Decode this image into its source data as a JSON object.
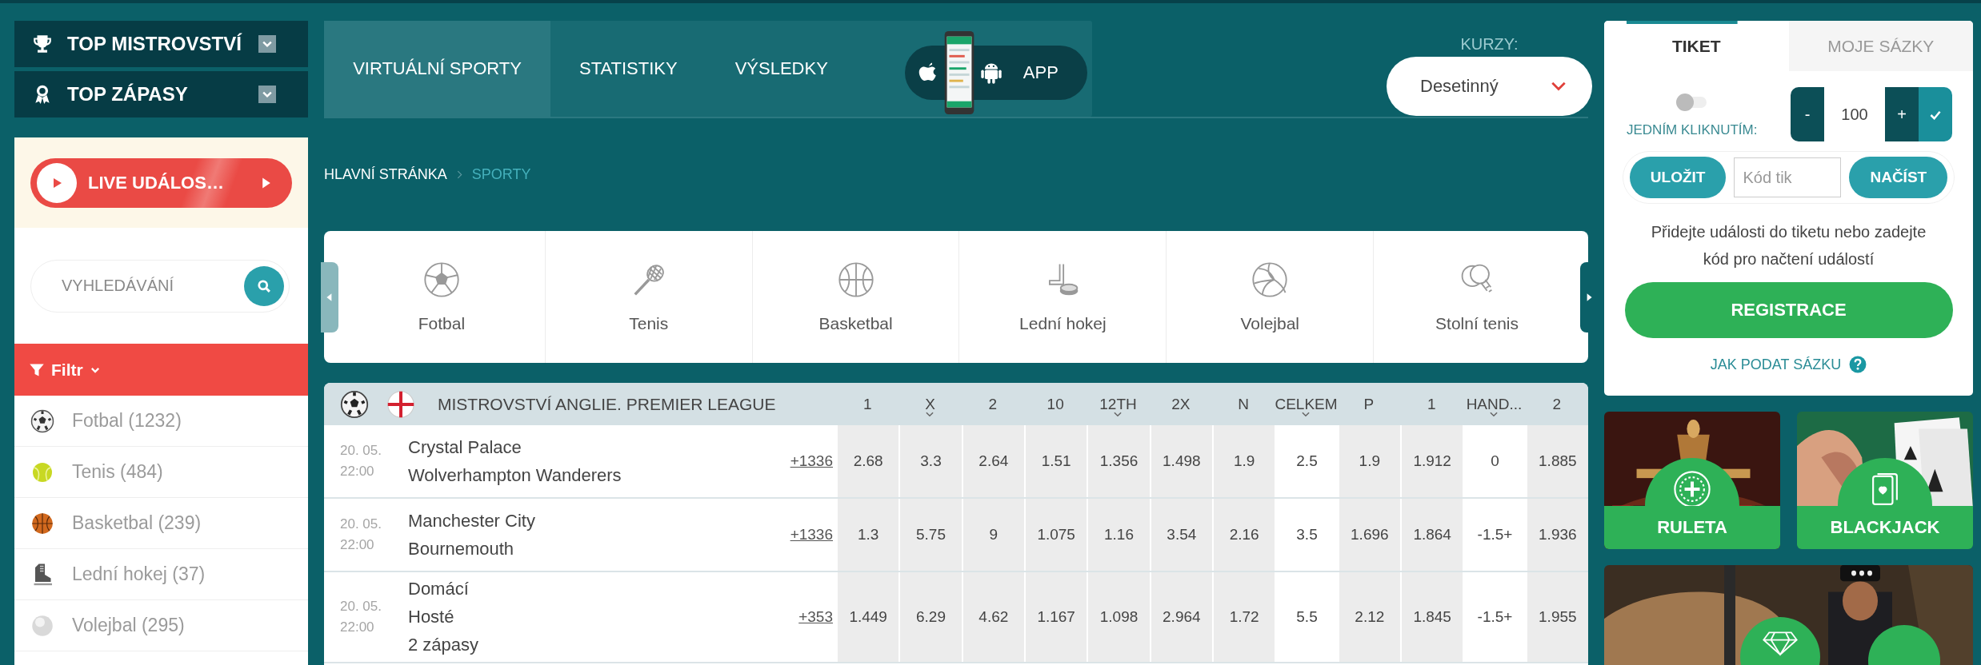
{
  "sidebar": {
    "menus": [
      {
        "label": "TOP MISTROVSTVÍ",
        "expanded": false
      },
      {
        "label": "TOP ZÁPASY",
        "expanded": false
      }
    ],
    "live_button": "LIVE UDÁLOS…",
    "search": {
      "placeholder": "VYHLEDÁVÁNÍ"
    },
    "filter": "Filtr",
    "sports": [
      {
        "label": "Fotbal (1232)"
      },
      {
        "label": "Tenis (484)"
      },
      {
        "label": "Basketbal (239)"
      },
      {
        "label": "Lední hokej (37)"
      },
      {
        "label": "Volejbal (295)"
      }
    ]
  },
  "nav": {
    "tabs": [
      {
        "label": "VIRTUÁLNÍ SPORTY",
        "selected": true
      },
      {
        "label": "STATISTIKY",
        "selected": false
      },
      {
        "label": "VÝSLEDKY",
        "selected": false
      }
    ],
    "app_label": "APP"
  },
  "odds_format": {
    "label": "KURZY:",
    "value": "Desetinný"
  },
  "breadcrumb": [
    {
      "label": "HLAVNÍ STRÁNKA",
      "current": false
    },
    {
      "label": "SPORTY",
      "current": true
    }
  ],
  "sports_carousel": [
    {
      "label": "Fotbal"
    },
    {
      "label": "Tenis"
    },
    {
      "label": "Basketbal"
    },
    {
      "label": "Lední hokej"
    },
    {
      "label": "Volejbal"
    },
    {
      "label": "Stolní tenis"
    }
  ],
  "table": {
    "league": "MISTROVSTVÍ ANGLIE. PREMIER LEAGUE",
    "columns": [
      {
        "label": "1",
        "expandable": false,
        "kind": "odds"
      },
      {
        "label": "X",
        "expandable": true,
        "kind": "odds"
      },
      {
        "label": "2",
        "expandable": false,
        "kind": "odds"
      },
      {
        "label": "10",
        "expandable": false,
        "kind": "odds"
      },
      {
        "label": "12TH",
        "expandable": true,
        "kind": "odds"
      },
      {
        "label": "2X",
        "expandable": false,
        "kind": "odds"
      },
      {
        "label": "N",
        "expandable": false,
        "kind": "odds"
      },
      {
        "label": "CELKEM",
        "expandable": true,
        "kind": "line"
      },
      {
        "label": "P",
        "expandable": false,
        "kind": "odds"
      },
      {
        "label": "1",
        "expandable": false,
        "kind": "odds"
      },
      {
        "label": "HAND...",
        "expandable": true,
        "kind": "line"
      },
      {
        "label": "2",
        "expandable": false,
        "kind": "odds"
      }
    ],
    "rows": [
      {
        "date": "20. 05.",
        "time": "22:00",
        "teams": [
          "Crystal Palace",
          "Wolverhampton Wanderers"
        ],
        "more": "+1336",
        "odds": [
          "2.68",
          "3.3",
          "2.64",
          "1.51",
          "1.356",
          "1.498",
          "1.9",
          "2.5",
          "1.9",
          "1.912",
          "0",
          "1.885"
        ]
      },
      {
        "date": "20. 05.",
        "time": "22:00",
        "teams": [
          "Manchester City",
          "Bournemouth"
        ],
        "more": "+1336",
        "odds": [
          "1.3",
          "5.75",
          "9",
          "1.075",
          "1.16",
          "3.54",
          "2.16",
          "3.5",
          "1.696",
          "1.864",
          "-1.5+",
          "1.936"
        ]
      },
      {
        "date": "20. 05.",
        "time": "22:00",
        "teams": [
          "Domácí",
          "Hosté",
          "2 zápasy"
        ],
        "more": "+353",
        "odds": [
          "1.449",
          "6.29",
          "4.62",
          "1.167",
          "1.098",
          "2.964",
          "1.72",
          "5.5",
          "2.12",
          "1.845",
          "-1.5+",
          "1.955"
        ]
      }
    ]
  },
  "ticket": {
    "tabs": [
      {
        "label": "TIKET",
        "selected": true
      },
      {
        "label": "MOJE SÁZKY",
        "selected": false
      }
    ],
    "one_click": {
      "label": "JEDNÍM KLIKNUTÍM:",
      "on": false
    },
    "stake": {
      "minus": "-",
      "value": "100",
      "plus": "+"
    },
    "save": "ULOŽIT",
    "code": {
      "placeholder": "Kód tik"
    },
    "load": "NAČÍST",
    "message": "Přidejte události do tiketu nebo zadejte kód pro načtení událostí",
    "register": "REGISTRACE",
    "help": "JAK PODAT SÁZKU"
  },
  "casino": [
    {
      "label": "RULETA"
    },
    {
      "label": "BLACKJACK"
    }
  ]
}
